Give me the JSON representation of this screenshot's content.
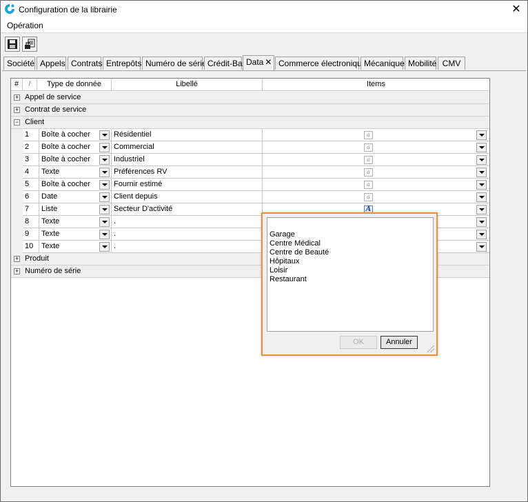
{
  "window": {
    "title": "Configuration de la librairie"
  },
  "menu": {
    "items": [
      "Opération"
    ]
  },
  "toolbar": {
    "buttons": [
      {
        "icon": "save-icon"
      },
      {
        "icon": "export-icon"
      }
    ]
  },
  "tabs": [
    {
      "label": "Société"
    },
    {
      "label": "Appels"
    },
    {
      "label": "Contrats"
    },
    {
      "label": "Entrepôts"
    },
    {
      "label": "Numéro de série"
    },
    {
      "label": "Crédit-Bail"
    },
    {
      "label": "Data"
    },
    {
      "label": "Commerce électronique"
    },
    {
      "label": "Mécanique"
    },
    {
      "label": "Mobilité"
    },
    {
      "label": "CMV"
    }
  ],
  "active_tab": "Data",
  "grid": {
    "columns": {
      "num": "#",
      "sort": "/",
      "type": "Type de donnée",
      "label": "Libellé",
      "items": "Items"
    },
    "groups_top": [
      {
        "label": "Appel de service",
        "expander": "+"
      },
      {
        "label": "Contrat de service",
        "expander": "+"
      },
      {
        "label": "Client",
        "expander": "−"
      }
    ],
    "rows": [
      {
        "num": "1",
        "type": "Boîte à cocher",
        "label": "Résidentiel",
        "items_active": false
      },
      {
        "num": "2",
        "type": "Boîte à cocher",
        "label": "Commercial",
        "items_active": false
      },
      {
        "num": "3",
        "type": "Boîte à cocher",
        "label": "Industriel",
        "items_active": false
      },
      {
        "num": "4",
        "type": "Texte",
        "label": "Préférences RV",
        "items_active": false
      },
      {
        "num": "5",
        "type": "Boîte à cocher",
        "label": "Fournir estimé",
        "items_active": false
      },
      {
        "num": "6",
        "type": "Date",
        "label": "Client depuis",
        "items_active": false
      },
      {
        "num": "7",
        "type": "Liste",
        "label": "Secteur D'activité",
        "items_active": true
      },
      {
        "num": "8",
        "type": "Texte",
        "label": ".",
        "items_active": false
      },
      {
        "num": "9",
        "type": "Texte",
        "label": ".",
        "items_active": false
      },
      {
        "num": "10",
        "type": "Texte",
        "label": ".",
        "items_active": false
      }
    ],
    "groups_bottom": [
      {
        "label": "Produit",
        "expander": "+"
      },
      {
        "label": "Numéro de série",
        "expander": "+"
      }
    ]
  },
  "popup": {
    "items": [
      "Garage",
      "Centre Médical",
      "Centre de Beauté",
      "Hôpitaux",
      "Loisir",
      "Restaurant"
    ],
    "ok_label": "OK",
    "cancel_label": "Annuler"
  },
  "colors": {
    "highlight_border": "#e8923a",
    "accent_blue": "#1f4ea8"
  }
}
